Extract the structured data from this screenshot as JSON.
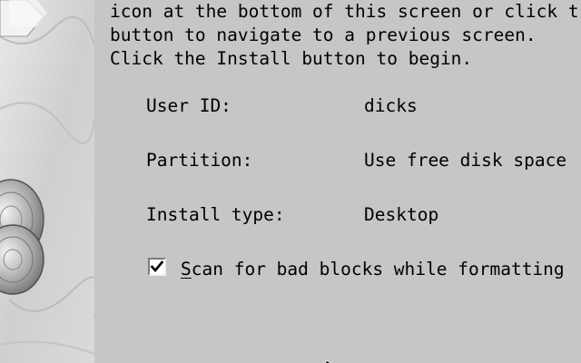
{
  "intro": {
    "line1": "icon at the bottom of this screen or click t",
    "line2": "button to navigate to a previous screen.",
    "line3": "Click the Install button to begin."
  },
  "summary": {
    "user_id": {
      "label": "User ID:",
      "value": "dicks"
    },
    "partition": {
      "label": "Partition:",
      "value": "Use free disk space"
    },
    "install_type": {
      "label": "Install type:",
      "value": "Desktop"
    }
  },
  "scan_option": {
    "checked": true,
    "label_first_letter": "S",
    "label_rest": "can for bad blocks while formatting"
  },
  "icons": {
    "side_art": "decorative-disc-art",
    "cursor": "mouse-pointer-icon",
    "check": "checkmark-icon"
  },
  "colors": {
    "background": "#c6c6c6",
    "text": "#000000"
  }
}
